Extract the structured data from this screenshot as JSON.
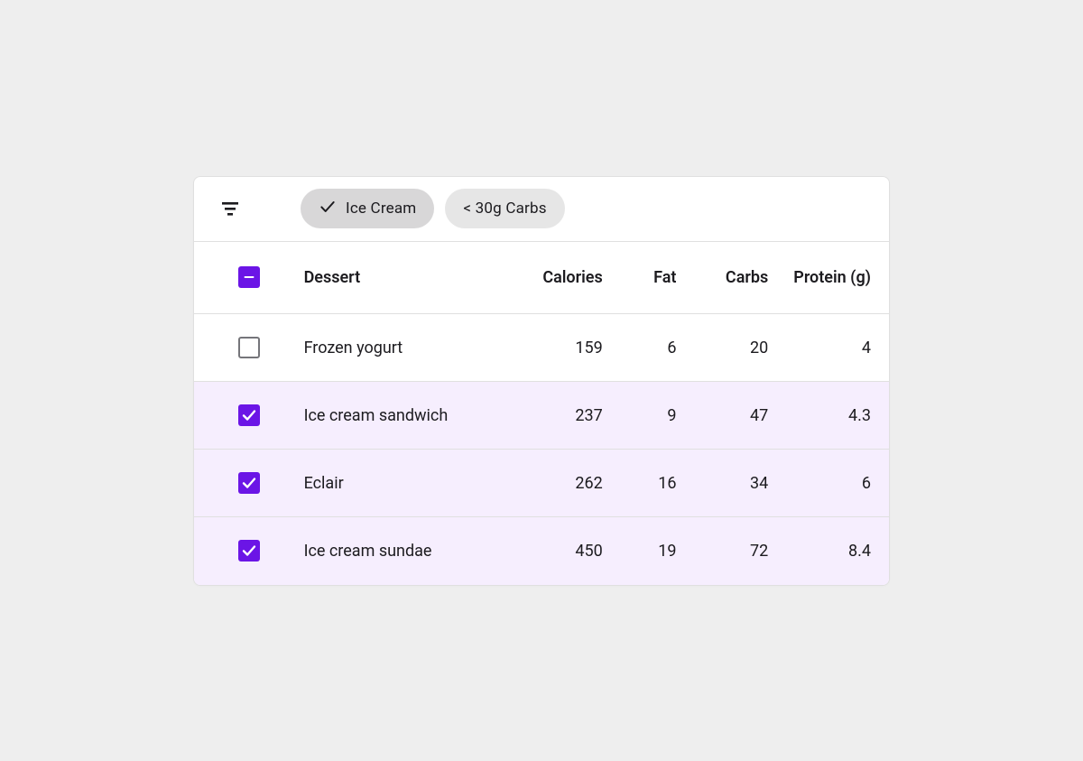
{
  "accent": "#6b15e6",
  "filters": [
    {
      "label": "Ice Cream",
      "selected": true
    },
    {
      "label": "< 30g Carbs",
      "selected": false
    }
  ],
  "columns": {
    "dessert": "Dessert",
    "calories": "Calories",
    "fat": "Fat",
    "carbs": "Carbs",
    "protein": "Protein (g)"
  },
  "header_checkbox_state": "indeterminate",
  "rows": [
    {
      "selected": false,
      "dessert": "Frozen yogurt",
      "calories": 159,
      "fat": 6,
      "carbs": 20,
      "protein": 4
    },
    {
      "selected": true,
      "dessert": "Ice cream sandwich",
      "calories": 237,
      "fat": 9,
      "carbs": 47,
      "protein": 4.3
    },
    {
      "selected": true,
      "dessert": "Eclair",
      "calories": 262,
      "fat": 16,
      "carbs": 34,
      "protein": 6
    },
    {
      "selected": true,
      "dessert": "Ice cream sundae",
      "calories": 450,
      "fat": 19,
      "carbs": 72,
      "protein": 8.4
    }
  ]
}
